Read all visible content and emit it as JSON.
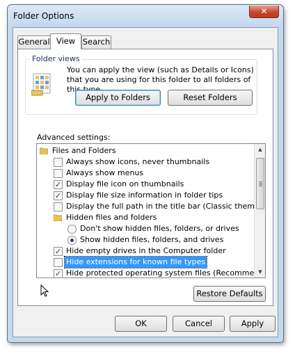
{
  "window": {
    "title": "Folder Options",
    "close_glyph": "✕"
  },
  "tabs": [
    {
      "label": "General",
      "active": false
    },
    {
      "label": "View",
      "active": true
    },
    {
      "label": "Search",
      "active": false
    }
  ],
  "folder_views": {
    "label": "Folder views",
    "description": "You can apply the view (such as Details or Icons) that you are using for this folder to all folders of this type.",
    "apply_button": "Apply to Folders",
    "reset_button": "Reset Folders",
    "icon": "folder-view-icon"
  },
  "advanced": {
    "label": "Advanced settings:",
    "items": [
      {
        "kind": "folder",
        "label": "Files and Folders"
      },
      {
        "kind": "checkbox",
        "checked": false,
        "label": "Always show icons, never thumbnails"
      },
      {
        "kind": "checkbox",
        "checked": false,
        "label": "Always show menus"
      },
      {
        "kind": "checkbox",
        "checked": true,
        "label": "Display file icon on thumbnails"
      },
      {
        "kind": "checkbox",
        "checked": true,
        "label": "Display file size information in folder tips"
      },
      {
        "kind": "checkbox",
        "checked": false,
        "label": "Display the full path in the title bar (Classic theme only)"
      },
      {
        "kind": "folder",
        "label": "Hidden files and folders"
      },
      {
        "kind": "radio",
        "checked": false,
        "label": "Don't show hidden files, folders, or drives"
      },
      {
        "kind": "radio",
        "checked": true,
        "label": "Show hidden files, folders, and drives"
      },
      {
        "kind": "checkbox",
        "checked": true,
        "label": "Hide empty drives in the Computer folder"
      },
      {
        "kind": "checkbox",
        "checked": false,
        "label": "Hide extensions for known file types",
        "selected": true
      },
      {
        "kind": "checkbox",
        "checked": true,
        "label": "Hide protected operating system files (Recommended)"
      }
    ]
  },
  "restore_defaults": "Restore Defaults",
  "footer": {
    "ok": "OK",
    "cancel": "Cancel",
    "apply": "Apply"
  },
  "colors": {
    "selection": "#3399ff",
    "frame": "#c5d9ee",
    "close_button": "#c9462c"
  }
}
